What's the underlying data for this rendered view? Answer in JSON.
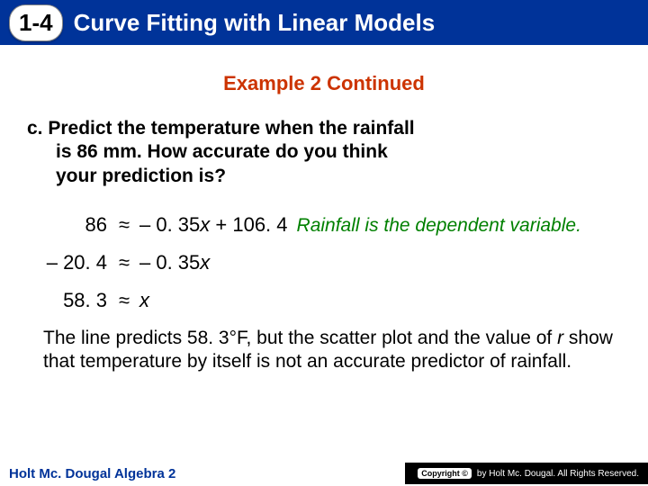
{
  "header": {
    "lesson_number": "1-4",
    "title": "Curve Fitting with Linear Models"
  },
  "example_heading": "Example 2 Continued",
  "question": {
    "label": "c.",
    "line1": "Predict the temperature when the rainfall",
    "line2": "is 86 mm. How accurate do you think",
    "line3": "your prediction is?"
  },
  "work": {
    "line1_lhs": "86",
    "line1_approx": "≈",
    "line1_rhs_a": "– 0. 35",
    "line1_rhs_x": "x",
    "line1_rhs_b": " + 106. 4",
    "line1_note": "Rainfall is the dependent variable.",
    "line2_lhs": "– 20. 4",
    "line2_approx": "≈",
    "line2_rhs_a": "– 0. 35",
    "line2_rhs_x": "x",
    "line3_lhs": "58. 3",
    "line3_approx": "≈",
    "line3_rhs_x": "x"
  },
  "conclusion_a": "The line predicts 58. 3°F, but the scatter plot and the value of ",
  "conclusion_r": "r",
  "conclusion_b": " show that temperature by itself is not an accurate predictor of rainfall.",
  "footer": {
    "left": "Holt Mc. Dougal Algebra 2",
    "badge": "Copyright ©",
    "right": "by Holt Mc. Dougal. All Rights Reserved."
  }
}
